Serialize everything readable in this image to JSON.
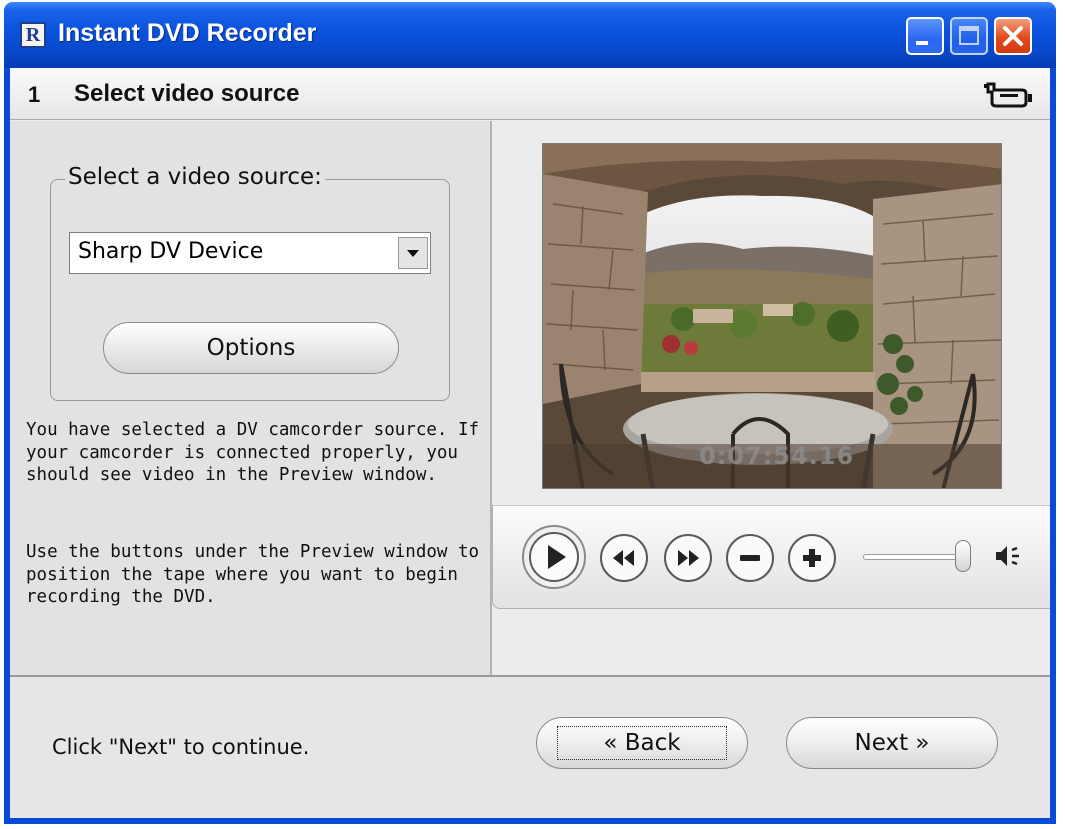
{
  "window": {
    "title": "Instant DVD Recorder",
    "app_icon_letter": "R"
  },
  "step": {
    "number": "1",
    "title": "Select video source"
  },
  "source": {
    "group_label": "Select a video source:",
    "selected": "Sharp DV Device",
    "options_label": "Options"
  },
  "description": {
    "paragraph1": "You have selected a DV camcorder source. If your camcorder is connected properly, you should see video in the Preview window.",
    "paragraph2": "Use the buttons under the Preview window to position the tape where you want to begin recording the DVD."
  },
  "preview": {
    "timecode": "0:07:54.16"
  },
  "transport": {
    "volume_level": 1.0
  },
  "footer": {
    "hint": "Click \"Next\" to continue.",
    "back_label": "« Back",
    "next_label": "Next »"
  },
  "colors": {
    "titlebar": "#0a52dc",
    "close_button": "#e24a1c",
    "client_bg": "#ececec"
  }
}
